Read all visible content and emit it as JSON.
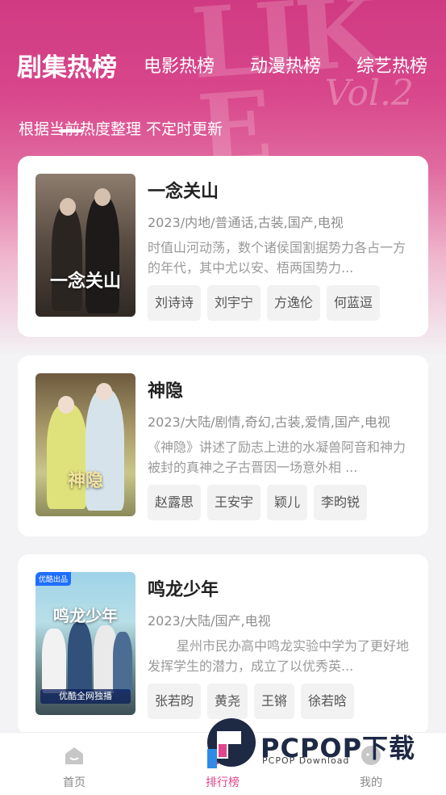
{
  "header": {
    "tabs": [
      {
        "label": "剧集热榜",
        "active": true
      },
      {
        "label": "电影热榜",
        "active": false
      },
      {
        "label": "动漫热榜",
        "active": false
      },
      {
        "label": "综艺热榜",
        "active": false
      }
    ],
    "subtitle": "根据当前热度整理 不定时更新"
  },
  "shows": [
    {
      "title": "一念关山",
      "meta": "2023/内地/普通话,古装,国产,电视",
      "desc": "时值山河动荡，数个诸侯国割据势力各占一方的年代，其中尤以安、梧两国势力...",
      "tags": [
        "刘诗诗",
        "刘宇宁",
        "方逸伦",
        "何蓝逗"
      ],
      "poster_text": "一念关山"
    },
    {
      "title": "神隐",
      "meta": "2023/大陆/剧情,奇幻,古装,爱情,国产,电视",
      "desc": "《神隐》讲述了励志上进的水凝兽阿音和神力被封的真神之子古晋因一场意外相 ...",
      "tags": [
        "赵露思",
        "王安宇",
        "颖儿",
        "李昀锐"
      ],
      "poster_text": "神隐"
    },
    {
      "title": "鸣龙少年",
      "meta": "2023/大陆/国产,电视",
      "desc": "星州市民办高中鸣龙实验中学为了更好地发挥学生的潜力，成立了以优秀英...",
      "tags": [
        "张若昀",
        "黄尧",
        "王锵",
        "徐若晗"
      ],
      "poster_text": "鸣龙少年",
      "poster_badge": "优酷出品",
      "poster_banner": "优酷全网独播"
    }
  ],
  "nav": {
    "items": [
      {
        "label": "首页",
        "icon": "home-icon"
      },
      {
        "label": "排行榜",
        "icon": "ranking-icon",
        "active": true
      },
      {
        "label": "我的",
        "icon": "profile-icon"
      }
    ]
  },
  "watermark": {
    "text": "PCPOP下载",
    "sub": "PCPOP Download"
  },
  "colors": {
    "accent": "#e0468d",
    "hero_top": "#d03a82"
  }
}
